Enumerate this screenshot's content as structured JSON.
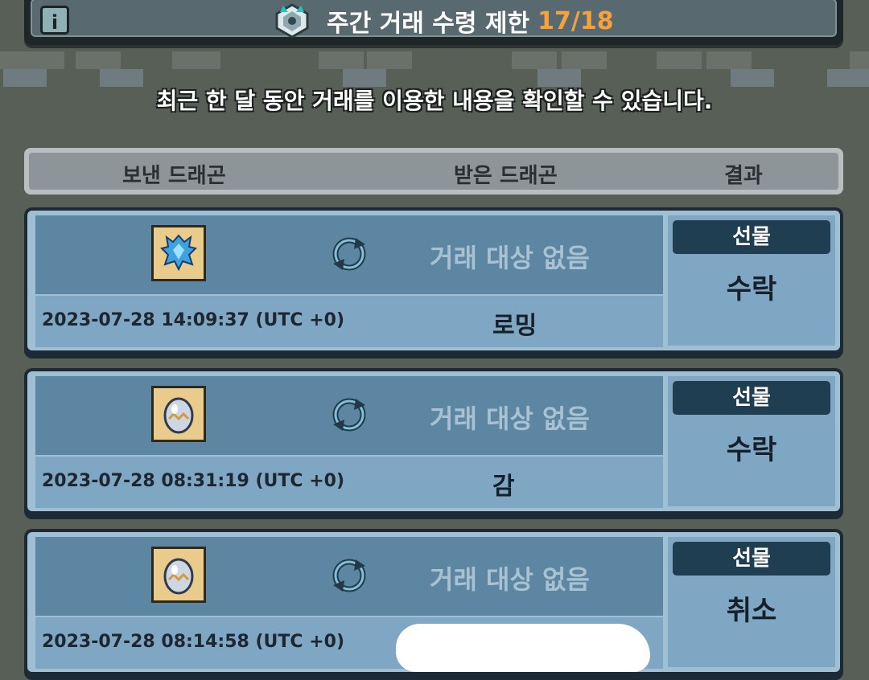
{
  "header": {
    "info_icon": "info-icon",
    "emblem_icon": "dragon-emblem-icon",
    "title": "주간 거래 수령 제한",
    "count": "17/18",
    "count_color": "#f7a13d"
  },
  "subtitle": "최근 한 달 동안 거래를 이용한 내용을 확인할 수 있습니다.",
  "columns": {
    "sent": "보낸 드래곤",
    "received": "받은 드래곤",
    "result": "결과"
  },
  "trades": [
    {
      "item_icon": "blue-crystal-dragon-icon",
      "swap_icon": "swap-arrows-icon",
      "target": "거래 대상 없음",
      "time": "2023-07-28 14:09:37 (UTC +0)",
      "name": "로밍",
      "type": "선물",
      "result": "수락"
    },
    {
      "item_icon": "dragon-egg-icon",
      "swap_icon": "swap-arrows-icon",
      "target": "거래 대상 없음",
      "time": "2023-07-28 08:31:19 (UTC +0)",
      "name": "감",
      "type": "선물",
      "result": "수락"
    },
    {
      "item_icon": "dragon-egg-icon",
      "swap_icon": "swap-arrows-icon",
      "target": "거래 대상 없음",
      "time": "2023-07-28 08:14:58 (UTC +0)",
      "name": "",
      "type": "선물",
      "result": "취소"
    }
  ]
}
